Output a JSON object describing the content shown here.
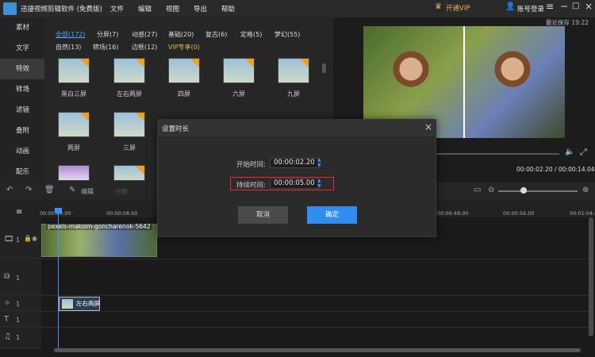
{
  "titlebar": {
    "app_title": "迅捷视频剪辑软件 (免费版)",
    "menus": [
      "文件",
      "编辑",
      "视图",
      "导出",
      "帮助"
    ],
    "vip": "开通VIP",
    "login": "账号登录"
  },
  "left_tabs": [
    "素材",
    "文字",
    "特效",
    "转场",
    "滤镜",
    "叠附",
    "动画",
    "配乐"
  ],
  "library": {
    "categories_row1": [
      "全部(172)",
      "分屏(7)",
      "动感(27)",
      "基础(20)",
      "复古(6)",
      "定格(5)",
      "梦幻(55)"
    ],
    "categories_row2": [
      "自然(13)",
      "转场(16)",
      "边框(12)",
      "VIP专享(0)"
    ],
    "items": [
      "黑白三屏",
      "左右两屏",
      "四屏",
      "六屏",
      "九屏",
      "两屏",
      "三屏"
    ]
  },
  "preview": {
    "saved": "最近保存 19:22",
    "time": "00:00:02.20 / 00:00:14.04"
  },
  "toolbar": {
    "edit": "编辑",
    "split": "分割"
  },
  "ruler": [
    "00:00:00.00",
    "00:00:08.00",
    "00:00:48.00",
    "00:00:56.00",
    "00:01:04.00"
  ],
  "timeline": {
    "clip_name": "pexels-maksim-goncharenok-5642",
    "effect_clip": "左右两屏",
    "track_nums": [
      "1",
      "1",
      "1",
      "1",
      "1"
    ]
  },
  "dialog": {
    "title": "设置时长",
    "start_label": "开始时间:",
    "start_value": "00:00:02.20",
    "duration_label": "持续时间:",
    "duration_value": "00:00:05.00",
    "cancel": "取消",
    "ok": "确定"
  }
}
